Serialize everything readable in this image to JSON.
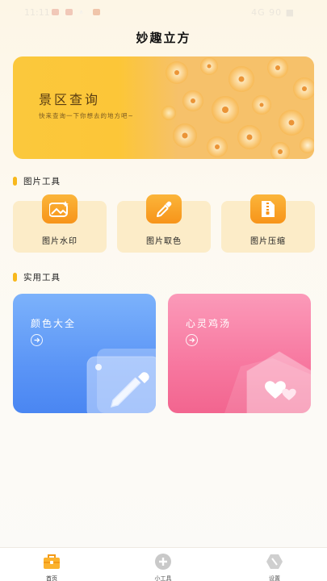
{
  "status_bar": {
    "time": "11:11",
    "right": "4G 90 ■"
  },
  "app": {
    "title": "妙趣立方"
  },
  "banner": {
    "title": "景区查询",
    "subtitle": "快来查询一下你想去的地方吧~"
  },
  "sections": {
    "image_tools": "图片工具",
    "utility_tools": "实用工具"
  },
  "image_tools": [
    {
      "label": "图片水印",
      "icon": "image-watermark-icon"
    },
    {
      "label": "图片取色",
      "icon": "eyedropper-icon"
    },
    {
      "label": "图片压缩",
      "icon": "zip-compress-icon"
    }
  ],
  "utility_cards": [
    {
      "title": "颜色大全",
      "icon": "eyedropper-icon",
      "color": "#5b95f6"
    },
    {
      "title": "心灵鸡汤",
      "icon": "hearts-icon",
      "color": "#f7779f"
    }
  ],
  "tab_bar": [
    {
      "label": "首页",
      "icon": "toolbox-icon",
      "active": true
    },
    {
      "label": "小工具",
      "icon": "plus-circle-icon",
      "active": false
    },
    {
      "label": "设置",
      "icon": "settings-hexagon-icon",
      "active": false
    }
  ],
  "colors": {
    "accent": "#f8b81c",
    "banner": "#fbc83c",
    "tool_card_bg": "#fcecc8"
  }
}
